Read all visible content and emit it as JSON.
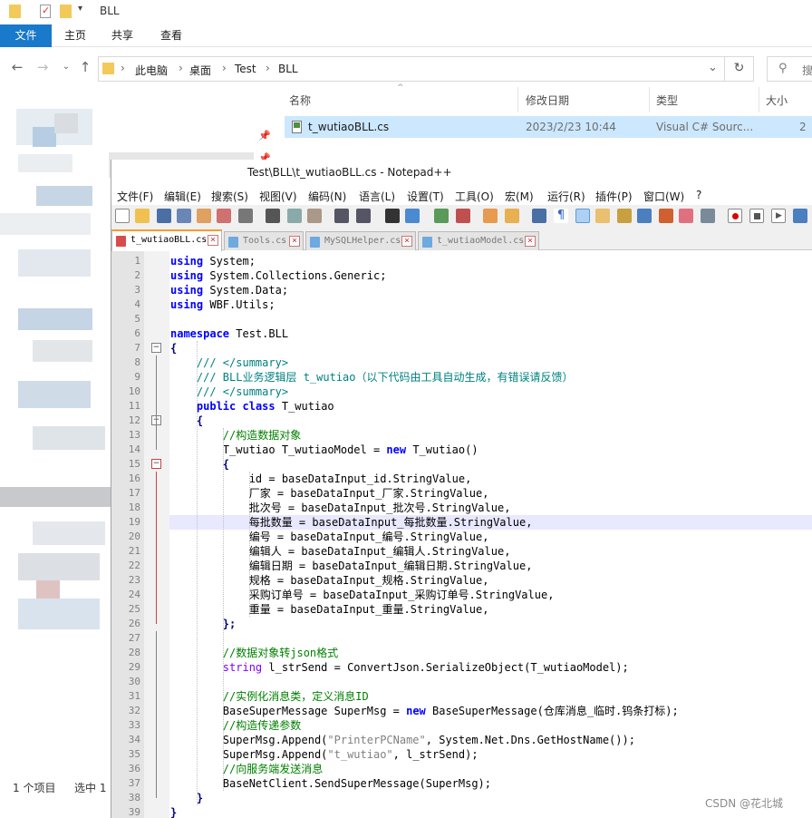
{
  "explorer": {
    "title": "BLL",
    "ribbon_tabs": [
      "文件",
      "主页",
      "共享",
      "查看"
    ],
    "breadcrumb": [
      "此电脑",
      "桌面",
      "Test",
      "BLL"
    ],
    "search_placeholder": "搜",
    "columns": [
      "名称",
      "修改日期",
      "类型",
      "大小"
    ],
    "file": {
      "name": "t_wutiaoBLL.cs",
      "modified": "2023/2/23 10:44",
      "type": "Visual C# Sourc...",
      "size": "2"
    },
    "status_items": "1 个项目",
    "status_selected": "选中 1"
  },
  "notepad": {
    "title": "Test\\BLL\\t_wutiaoBLL.cs - Notepad++",
    "menu": [
      "文件(F)",
      "编辑(E)",
      "搜索(S)",
      "视图(V)",
      "编码(N)",
      "语言(L)",
      "设置(T)",
      "工具(O)",
      "宏(M)",
      "运行(R)",
      "插件(P)",
      "窗口(W)",
      "?"
    ],
    "tabs": [
      {
        "label": "t_wutiaoBLL.cs",
        "active": true
      },
      {
        "label": "Tools.cs",
        "active": false
      },
      {
        "label": "MySQLHelper.cs",
        "active": false
      },
      {
        "label": "t_wutiaoModel.cs",
        "active": false
      }
    ],
    "highlighted_line": 19,
    "lines": [
      [
        [
          "kw",
          "using"
        ],
        [
          "t",
          " System;"
        ]
      ],
      [
        [
          "kw",
          "using"
        ],
        [
          "t",
          " System.Collections.Generic;"
        ]
      ],
      [
        [
          "kw",
          "using"
        ],
        [
          "t",
          " System.Data;"
        ]
      ],
      [
        [
          "kw",
          "using"
        ],
        [
          "t",
          " WBF.Utils;"
        ]
      ],
      [],
      [
        [
          "kw",
          "namespace"
        ],
        [
          "t",
          " Test.BLL"
        ]
      ],
      [
        [
          "op",
          "{"
        ]
      ],
      [
        [
          "t",
          "    "
        ],
        [
          "dc",
          "/// </summary>"
        ]
      ],
      [
        [
          "t",
          "    "
        ],
        [
          "dc",
          "/// BLL业务逻辑层 t_wutiao（以下代码由工具自动生成，有错误请反馈）"
        ]
      ],
      [
        [
          "t",
          "    "
        ],
        [
          "dc",
          "/// </summary>"
        ]
      ],
      [
        [
          "t",
          "    "
        ],
        [
          "kw",
          "public"
        ],
        [
          "t",
          " "
        ],
        [
          "kw",
          "class"
        ],
        [
          "t",
          " T_wutiao"
        ]
      ],
      [
        [
          "t",
          "    "
        ],
        [
          "op",
          "{"
        ]
      ],
      [
        [
          "t",
          "        "
        ],
        [
          "cm",
          "//构造数据对象"
        ]
      ],
      [
        [
          "t",
          "        T_wutiao T_wutiaoModel = "
        ],
        [
          "kw",
          "new"
        ],
        [
          "t",
          " T_wutiao()"
        ]
      ],
      [
        [
          "t",
          "        "
        ],
        [
          "op",
          "{"
        ]
      ],
      [
        [
          "t",
          "            id = baseDataInput_id.StringValue,"
        ]
      ],
      [
        [
          "t",
          "            厂家 = baseDataInput_厂家.StringValue,"
        ]
      ],
      [
        [
          "t",
          "            批次号 = baseDataInput_批次号.StringValue,"
        ]
      ],
      [
        [
          "t",
          "            每批数量 = baseDataInput_每批数量.StringValue,"
        ]
      ],
      [
        [
          "t",
          "            编号 = baseDataInput_编号.StringValue,"
        ]
      ],
      [
        [
          "t",
          "            编辑人 = baseDataInput_编辑人.StringValue,"
        ]
      ],
      [
        [
          "t",
          "            编辑日期 = baseDataInput_编辑日期.StringValue,"
        ]
      ],
      [
        [
          "t",
          "            规格 = baseDataInput_规格.StringValue,"
        ]
      ],
      [
        [
          "t",
          "            采购订单号 = baseDataInput_采购订单号.StringValue,"
        ]
      ],
      [
        [
          "t",
          "            重量 = baseDataInput_重量.StringValue,"
        ]
      ],
      [
        [
          "t",
          "        "
        ],
        [
          "op",
          "};"
        ]
      ],
      [],
      [
        [
          "t",
          "        "
        ],
        [
          "cm",
          "//数据对象转json格式"
        ]
      ],
      [
        [
          "t",
          "        "
        ],
        [
          "kw2",
          "string"
        ],
        [
          "t",
          " l_strSend = ConvertJson.SerializeObject(T_wutiaoModel);"
        ]
      ],
      [],
      [
        [
          "t",
          "        "
        ],
        [
          "cm",
          "//实例化消息类，定义消息ID"
        ]
      ],
      [
        [
          "t",
          "        BaseSuperMessage SuperMsg = "
        ],
        [
          "kw",
          "new"
        ],
        [
          "t",
          " BaseSuperMessage(仓库消息_临时.钨条打标);"
        ]
      ],
      [
        [
          "t",
          "        "
        ],
        [
          "cm",
          "//构造传递参数"
        ]
      ],
      [
        [
          "t",
          "        SuperMsg.Append("
        ],
        [
          "st",
          "\"PrinterPCName\""
        ],
        [
          "t",
          ", System.Net.Dns.GetHostName());"
        ]
      ],
      [
        [
          "t",
          "        SuperMsg.Append("
        ],
        [
          "st",
          "\"t_wutiao\""
        ],
        [
          "t",
          ", l_strSend);"
        ]
      ],
      [
        [
          "t",
          "        "
        ],
        [
          "cm",
          "//向服务端发送消息"
        ]
      ],
      [
        [
          "t",
          "        BaseNetClient.SendSuperMessage(SuperMsg);"
        ]
      ],
      [
        [
          "t",
          "    "
        ],
        [
          "op",
          "}"
        ]
      ],
      [
        [
          "op",
          "}"
        ]
      ]
    ]
  },
  "watermark": "CSDN @花北城",
  "colors": {
    "ribbon_file": "#1979ca",
    "selection": "#cce8ff",
    "keyword": "#0000ff",
    "comment": "#008000",
    "doc_comment": "#008080",
    "line_highlight": "#e8e8ff"
  }
}
